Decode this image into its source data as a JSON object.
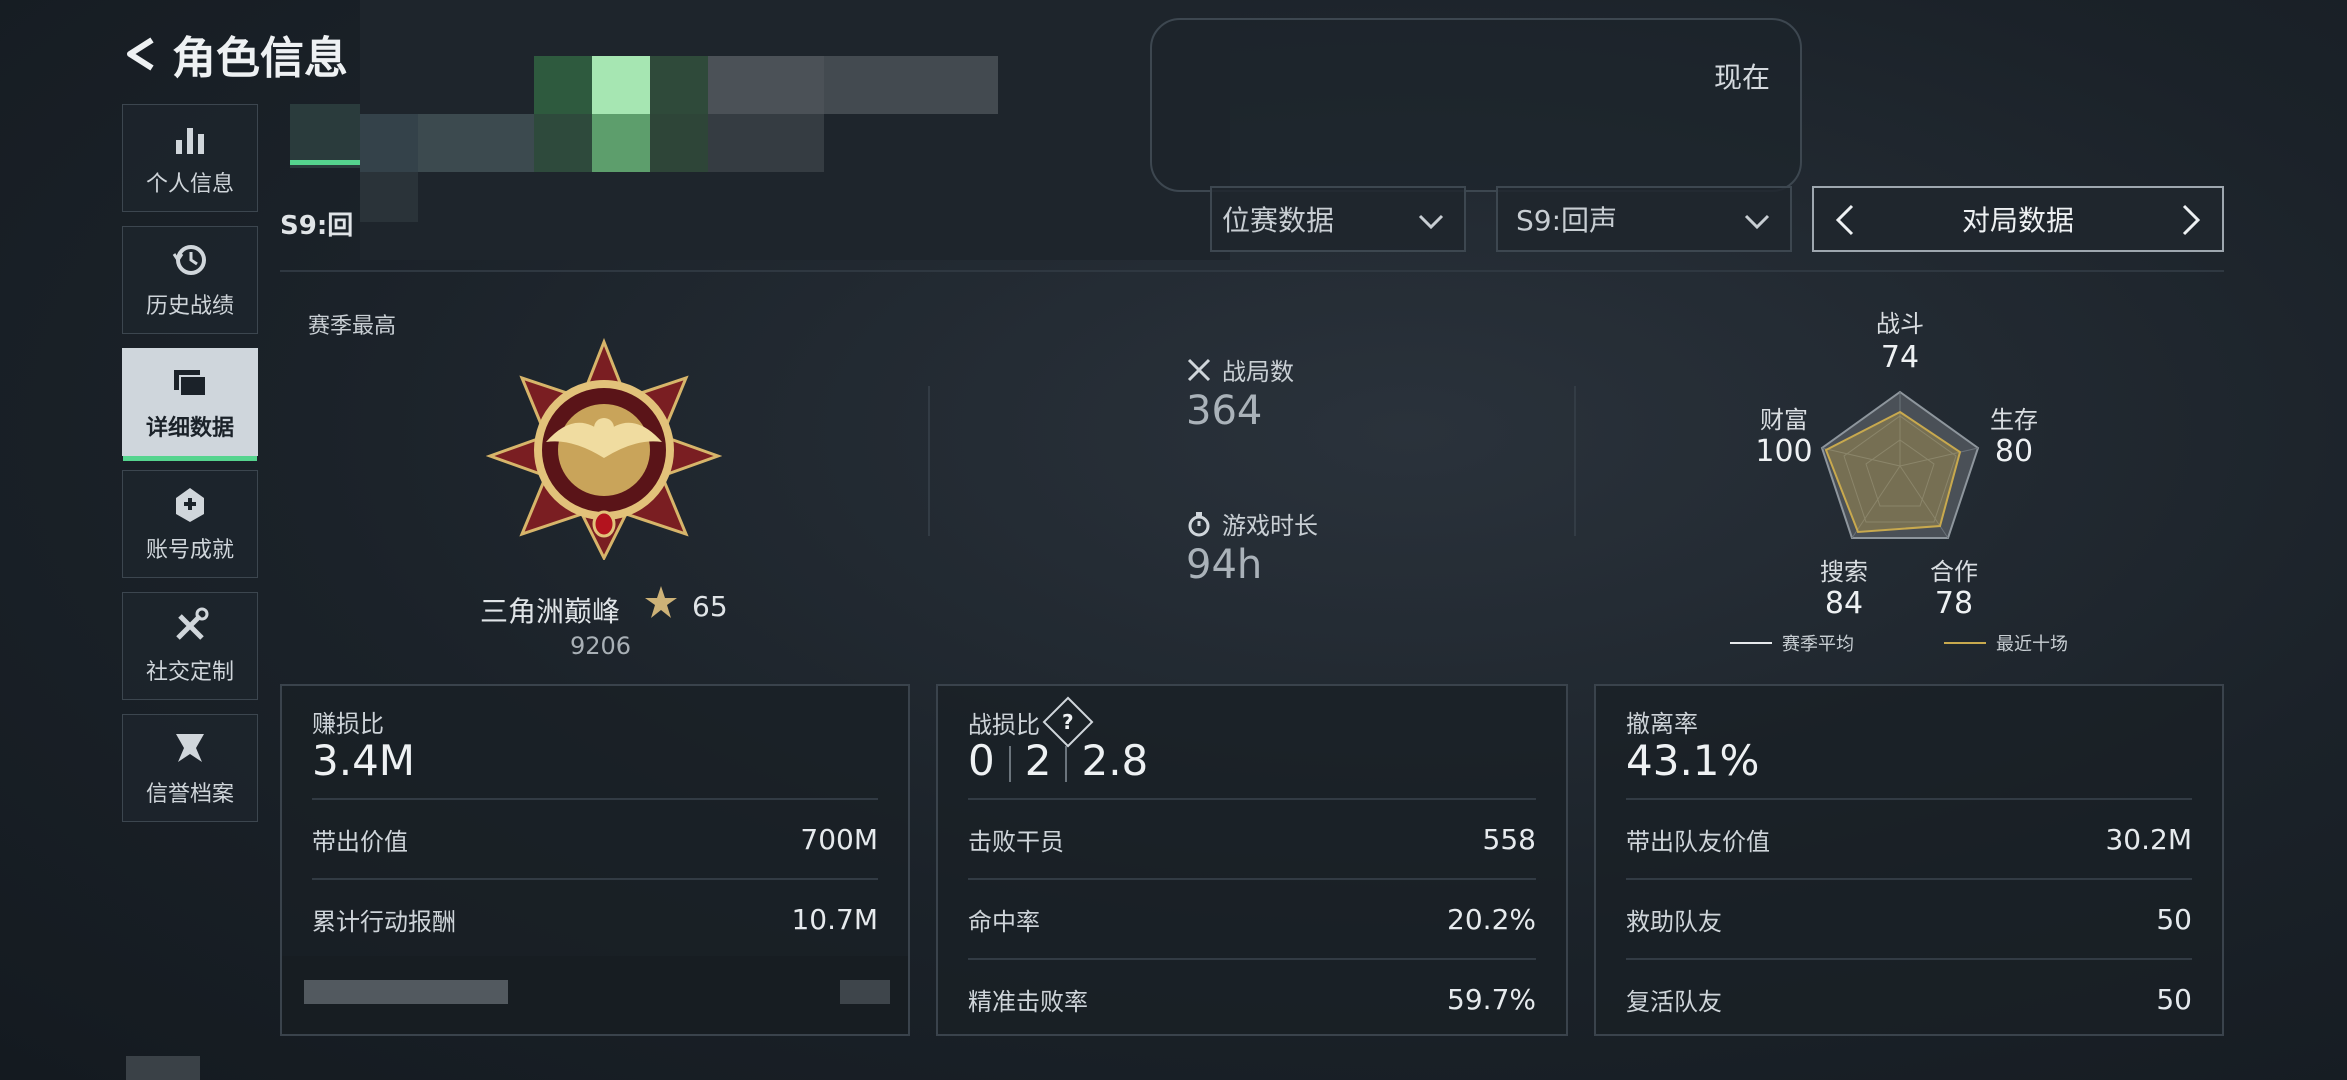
{
  "header": {
    "title": "角色信息"
  },
  "sidebar": {
    "items": [
      {
        "label": "个人信息",
        "icon": "bar-chart-icon"
      },
      {
        "label": "历史战绩",
        "icon": "history-icon"
      },
      {
        "label": "详细数据",
        "icon": "folder-icon",
        "active": true
      },
      {
        "label": "账号成就",
        "icon": "achievement-icon"
      },
      {
        "label": "社交定制",
        "icon": "tools-icon"
      },
      {
        "label": "信誉档案",
        "icon": "shield-icon"
      }
    ]
  },
  "top_panel": {
    "time_label": "现在"
  },
  "filters": {
    "season_prefix": "S9:回",
    "mode_dropdown": "位赛数据",
    "season_dropdown": "S9:回声",
    "pager_label": "对局数据"
  },
  "rank": {
    "season_best_label": "赛季最高",
    "name": "三角洲巅峰",
    "stars": "65",
    "score": "9206"
  },
  "summary": {
    "matches_label": "战局数",
    "matches_value": "364",
    "playtime_label": "游戏时长",
    "playtime_value": "94h"
  },
  "radar": {
    "combat_label": "战斗",
    "combat_value": "74",
    "survival_label": "生存",
    "survival_value": "80",
    "cooperation_label": "合作",
    "cooperation_value": "78",
    "search_label": "搜索",
    "search_value": "84",
    "wealth_label": "财富",
    "wealth_value": "100",
    "legend_season": "赛季平均",
    "legend_recent": "最近十场",
    "season_color": "#e6e9ec",
    "recent_color": "#c8a94e"
  },
  "cards": {
    "profit": {
      "title": "赚损比",
      "value": "3.4M",
      "rows": [
        {
          "label": "带出价值",
          "value": "700M"
        },
        {
          "label": "累计行动报酬",
          "value": "10.7M"
        }
      ]
    },
    "kd": {
      "title": "战损比",
      "values": [
        "0",
        "2",
        "2.8"
      ],
      "rows": [
        {
          "label": "击败干员",
          "value": "558"
        },
        {
          "label": "命中率",
          "value": "20.2%"
        },
        {
          "label": "精准击败率",
          "value": "59.7%"
        }
      ]
    },
    "extract": {
      "title": "撤离率",
      "value": "43.1%",
      "rows": [
        {
          "label": "带出队友价值",
          "value": "30.2M"
        },
        {
          "label": "救助队友",
          "value": "50"
        },
        {
          "label": "复活队友",
          "value": "50"
        }
      ]
    }
  }
}
